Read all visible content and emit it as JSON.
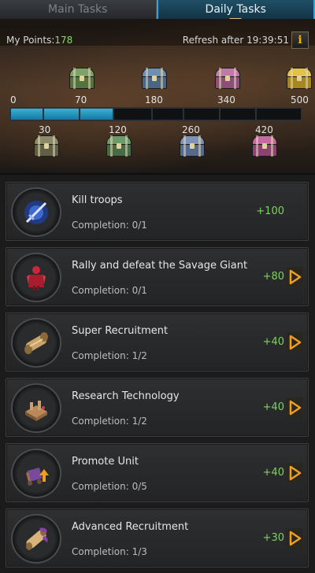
{
  "tabs": [
    {
      "label": "Main Tasks",
      "active": false
    },
    {
      "label": "Daily Tasks",
      "active": true
    }
  ],
  "header": {
    "points_label": "My Points:",
    "points_value": "178",
    "refresh_text": "Refresh after 19:39:51",
    "info_icon": "i"
  },
  "progress": {
    "current": 178,
    "max": 500,
    "fraction": 0.356,
    "milestones_top": [
      "0",
      "70",
      "180",
      "340",
      "500"
    ],
    "milestones_bottom": [
      "30",
      "120",
      "260",
      "420"
    ],
    "chest_colors": {
      "30": "#8a8a6a",
      "70": "#7fa26a",
      "120": "#6d9a6a",
      "180": "#6f8fb0",
      "260": "#7f92b8",
      "340": "#c07aa8",
      "420": "#c56aa0",
      "500": "#d9b640"
    }
  },
  "tasks": [
    {
      "title": "Kill troops",
      "completion": "Completion: 0/1",
      "reward": "+100",
      "icon": "sword-icon",
      "has_go": false
    },
    {
      "title": "Rally and defeat the Savage Giant",
      "completion": "Completion: 0/1",
      "reward": "+80",
      "icon": "giant-icon",
      "has_go": true
    },
    {
      "title": "Super Recruitment",
      "completion": "Completion: 1/2",
      "reward": "+40",
      "icon": "scroll-icon",
      "has_go": true
    },
    {
      "title": "Research Technology",
      "completion": "Completion: 1/2",
      "reward": "+40",
      "icon": "research-icon",
      "has_go": true
    },
    {
      "title": "Promote Unit",
      "completion": "Completion: 0/5",
      "reward": "+40",
      "icon": "promote-icon",
      "has_go": true
    },
    {
      "title": "Advanced Recruitment",
      "completion": "Completion: 1/3",
      "reward": "+30",
      "icon": "scroll-purple-icon",
      "has_go": true
    }
  ],
  "colors": {
    "accent_blue": "#2a9ac6",
    "reward_green": "#7ed35f",
    "points_green": "#8cd86a",
    "go_orange": "#f0a020"
  }
}
